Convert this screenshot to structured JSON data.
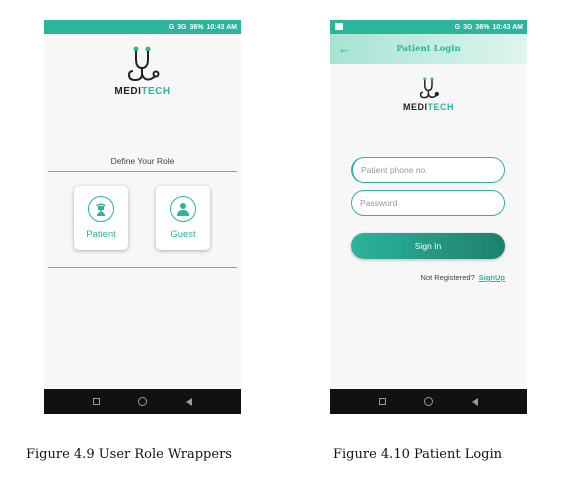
{
  "status_bar": {
    "network": "G",
    "network2": "3G",
    "battery": "36%",
    "time": "10:43 AM"
  },
  "colors": {
    "accent": "#2bb59c",
    "dark_accent": "#1e7f6e",
    "nav_bg": "#111111"
  },
  "screen1": {
    "logo_prefix": "MEDI",
    "logo_suffix": "TECH",
    "role_title": "Define Your Role",
    "roles": [
      {
        "label": "Patient",
        "icon": "patient-icon"
      },
      {
        "label": "Guest",
        "icon": "guest-icon"
      }
    ]
  },
  "screen2": {
    "title": "Patient Login",
    "logo_prefix": "MEDI",
    "logo_suffix": "TECH",
    "phone_placeholder": "Patient phone no.",
    "password_placeholder": "Password",
    "signin_label": "Sign In",
    "not_registered": "Not Registered?",
    "signup_label": "SignUp"
  },
  "captions": {
    "fig1": "Figure 4.9 User Role Wrappers",
    "fig2": "Figure 4.10 Patient Login"
  }
}
